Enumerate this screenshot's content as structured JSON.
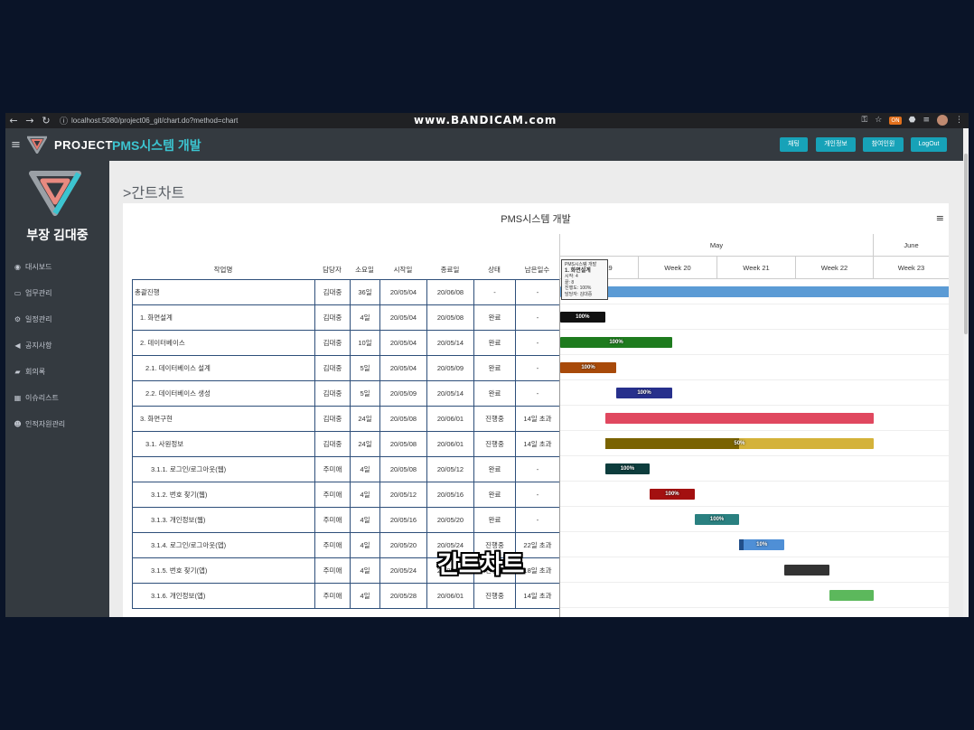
{
  "browser": {
    "url": "localhost:5080/project06_git/chart.do?method=chart",
    "watermark": "www.BANDICAM.com"
  },
  "header": {
    "brand": "PROJECT",
    "project_name": "PMS시스템 개발",
    "buttons": [
      "채팅",
      "개인정보",
      "참여인원",
      "LogOut"
    ]
  },
  "sidebar": {
    "user": "부장 김대중",
    "items": [
      {
        "label": "대시보드",
        "icon": "dashboard-icon"
      },
      {
        "label": "업무관리",
        "icon": "desktop-icon"
      },
      {
        "label": "일정관리",
        "icon": "cogs-icon"
      },
      {
        "label": "공지사항",
        "icon": "bullhorn-icon"
      },
      {
        "label": "회의록",
        "icon": "book-icon"
      },
      {
        "label": "이슈리스트",
        "icon": "grid-icon"
      },
      {
        "label": "인적자원관리",
        "icon": "users-icon"
      }
    ]
  },
  "page": {
    "title": ">간트차트",
    "chart_title": "PMS시스템 개발"
  },
  "grid": {
    "headers": [
      "작업명",
      "담당자",
      "소요일",
      "시작일",
      "종료일",
      "상태",
      "남은일수"
    ],
    "rows": [
      {
        "name": "총괄진행",
        "owner": "김대중",
        "days": "36일",
        "start": "20/05/04",
        "end": "20/06/08",
        "status": "-",
        "remain": "-"
      },
      {
        "name": "1. 화면설계",
        "owner": "김대중",
        "days": "4일",
        "start": "20/05/04",
        "end": "20/05/08",
        "status": "완료",
        "remain": "-"
      },
      {
        "name": "2. 데이터베이스",
        "owner": "김대중",
        "days": "10일",
        "start": "20/05/04",
        "end": "20/05/14",
        "status": "완료",
        "remain": "-"
      },
      {
        "name": "2.1. 데이터베이스 설계",
        "owner": "김대중",
        "days": "5일",
        "start": "20/05/04",
        "end": "20/05/09",
        "status": "완료",
        "remain": "-"
      },
      {
        "name": "2.2. 데이터베이스 생성",
        "owner": "김대중",
        "days": "5일",
        "start": "20/05/09",
        "end": "20/05/14",
        "status": "완료",
        "remain": "-"
      },
      {
        "name": "3. 화면구현",
        "owner": "김대중",
        "days": "24일",
        "start": "20/05/08",
        "end": "20/06/01",
        "status": "진행중",
        "remain": "14일 초과"
      },
      {
        "name": "3.1. 사원정보",
        "owner": "김대중",
        "days": "24일",
        "start": "20/05/08",
        "end": "20/06/01",
        "status": "진행중",
        "remain": "14일 초과"
      },
      {
        "name": "3.1.1. 로그인/로그아웃(웹)",
        "owner": "주미애",
        "days": "4일",
        "start": "20/05/08",
        "end": "20/05/12",
        "status": "완료",
        "remain": "-"
      },
      {
        "name": "3.1.2. 번호 찾기(웹)",
        "owner": "주미애",
        "days": "4일",
        "start": "20/05/12",
        "end": "20/05/16",
        "status": "완료",
        "remain": "-"
      },
      {
        "name": "3.1.3. 개인정보(웹)",
        "owner": "주미애",
        "days": "4일",
        "start": "20/05/16",
        "end": "20/05/20",
        "status": "완료",
        "remain": "-"
      },
      {
        "name": "3.1.4. 로그인/로그아웃(앱)",
        "owner": "주미애",
        "days": "4일",
        "start": "20/05/20",
        "end": "20/05/24",
        "status": "진행중",
        "remain": "22일 초과"
      },
      {
        "name": "3.1.5. 번호 찾기(앱)",
        "owner": "주미애",
        "days": "4일",
        "start": "20/05/24",
        "end": "20/05/28",
        "status": "진행중",
        "remain": "18일 초과"
      },
      {
        "name": "3.1.6. 개인정보(앱)",
        "owner": "주미애",
        "days": "4일",
        "start": "20/05/28",
        "end": "20/06/01",
        "status": "진행중",
        "remain": "14일 초과"
      }
    ]
  },
  "timeline": {
    "months": [
      "May",
      "June"
    ],
    "weeks": [
      "Week 19",
      "Week 20",
      "Week 21",
      "Week 22",
      "Week 23"
    ]
  },
  "bars": [
    {
      "color": "#5b9bd5",
      "progress": null,
      "label": ""
    },
    {
      "color": "#111111",
      "progress": 1.0,
      "label": "100%"
    },
    {
      "color": "#1e7b1e",
      "progress": 1.0,
      "label": "100%"
    },
    {
      "color": "#a84a0a",
      "progress": 1.0,
      "label": "100%"
    },
    {
      "color": "#27308c",
      "progress": 1.0,
      "label": "100%"
    },
    {
      "color": "#e0485f",
      "progress": null,
      "label": ""
    },
    {
      "color": "#d4b23a",
      "progress": 0.5,
      "progress_color": "#7a6300",
      "label": "50%"
    },
    {
      "color": "#0d3d3d",
      "progress": 1.0,
      "label": "100%"
    },
    {
      "color": "#a31010",
      "progress": 1.0,
      "label": "100%"
    },
    {
      "color": "#2a8080",
      "progress": 1.0,
      "label": "100%"
    },
    {
      "color": "#4f8fd6",
      "progress": 0.1,
      "progress_color": "#224f8a",
      "label": "10%"
    },
    {
      "color": "#333333",
      "progress": null,
      "label": ""
    },
    {
      "color": "#5cb85c",
      "progress": null,
      "label": ""
    }
  ],
  "tooltip": {
    "project": "PMS시스템 개발",
    "name": "1. 화면설계",
    "lines": [
      "시작: 4",
      "끝: 8",
      "진행도: 100%",
      "담당자: 김대중"
    ]
  },
  "caption": "간트차트"
}
